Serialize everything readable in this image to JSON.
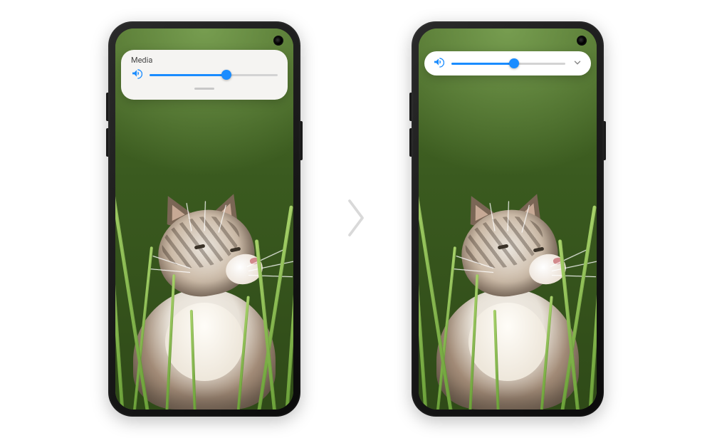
{
  "phone_left": {
    "volume_type_label": "Media",
    "volume_percent": 60,
    "slider_icon": "volume-icon",
    "accent_color": "#1a8cff"
  },
  "phone_right": {
    "volume_percent": 55,
    "slider_icon": "volume-icon",
    "expand_icon": "chevron-down-icon",
    "accent_color": "#1a8cff"
  },
  "separator_icon": "chevron-right-icon"
}
